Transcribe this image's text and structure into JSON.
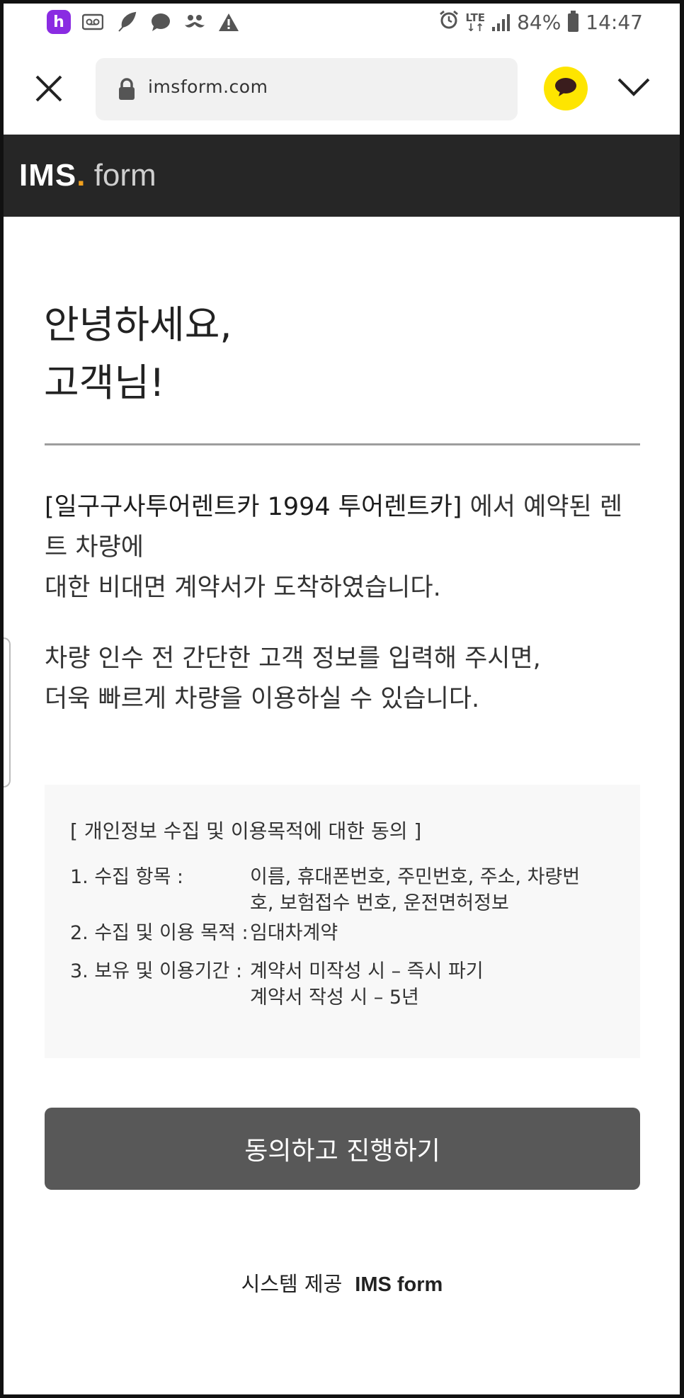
{
  "status_bar": {
    "battery": "84%",
    "time": "14:47",
    "network": "LTE",
    "app_icons": [
      "h-app-icon",
      "voicemail-icon",
      "feather-icon",
      "chat-bubble-icon",
      "mustache-icon",
      "warning-icon"
    ],
    "app_badge": "h"
  },
  "browser": {
    "url": "imsform.com"
  },
  "header": {
    "logo_ims": "IMS",
    "logo_dot": ".",
    "logo_form": " form"
  },
  "greeting": {
    "line1": "안녕하세요,",
    "line2": "고객님!"
  },
  "intro": {
    "company": "[일구구사투어렌트카 1994 투어렌트카]",
    "line1_rest": " 에서 예약된 렌트 차량에",
    "line2": "대한 비대면 계약서가 도착하였습니다.",
    "line3": "차량 인수 전 간단한 고객 정보를 입력해 주시면,",
    "line4": "더욱 빠르게 차량을 이용하실 수 있습니다."
  },
  "consent": {
    "title": "[ 개인정보 수집 및 이용목적에 대한 동의 ]",
    "items": [
      {
        "label": "1. 수집 항목 :",
        "value": "이름, 휴대폰번호, 주민번호, 주소, 차량번호, 보험접수 번호, 운전면허정보"
      },
      {
        "label": "2. 수집 및 이용 목적 :",
        "value": "임대차계약"
      },
      {
        "label": "3. 보유 및 이용기간 :",
        "value1": "계약서 미작성 시 – 즉시 파기",
        "value2": "계약서 작성 시 – 5년"
      }
    ]
  },
  "agree_button": "동의하고 진행하기",
  "footer": {
    "prefix": "시스템 제공",
    "brand": "IMS form"
  },
  "colors": {
    "header_bg": "#262626",
    "logo_dot": "#f0a01e",
    "button_bg": "#585858",
    "kakao_yellow": "#fee500",
    "consent_bg": "#f8f8f8"
  }
}
